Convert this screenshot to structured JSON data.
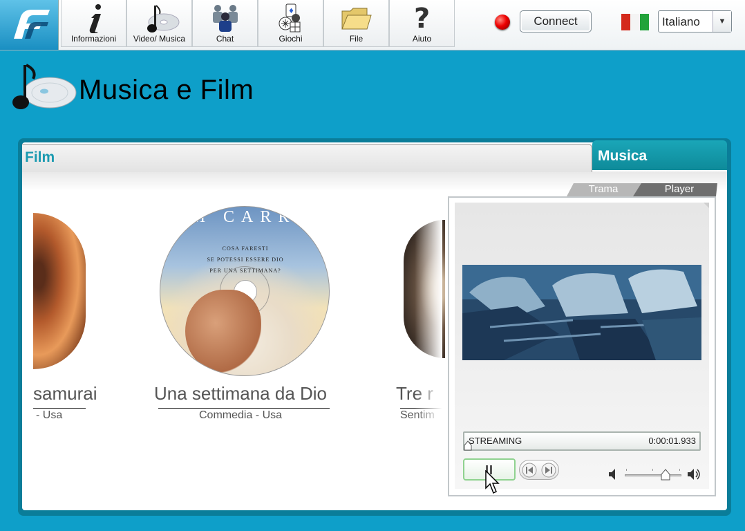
{
  "nav": {
    "items": [
      {
        "label": "Informazioni",
        "icon": "info-icon"
      },
      {
        "label": "Video/ Musica",
        "icon": "music-disc-icon"
      },
      {
        "label": "Chat",
        "icon": "chat-people-icon"
      },
      {
        "label": "Giochi",
        "icon": "games-icon"
      },
      {
        "label": "File",
        "icon": "folder-icon"
      },
      {
        "label": "Aiuto",
        "icon": "help-icon"
      }
    ]
  },
  "header": {
    "connect_label": "Connect",
    "status_color": "#e00000",
    "language": "Italiano",
    "flag_colors": [
      "#d42a1c",
      "#ffffff",
      "#22a33a"
    ]
  },
  "page": {
    "title": "Musica e Film"
  },
  "tabs": {
    "film": "Film",
    "musica": "Musica"
  },
  "carousel": {
    "items": [
      {
        "title": "samurai",
        "subtitle": "- Usa"
      },
      {
        "title": "Una settimana da Dio",
        "subtitle": "Commedia - Usa",
        "disc_text_top": "M CARR",
        "disc_text_lines": [
          "COSA FARESTI",
          "SE POTESSI ESSERE DIO",
          "PER UNA SETTIMANA?"
        ]
      },
      {
        "title": "Tre r",
        "subtitle": "Sentim"
      }
    ]
  },
  "player": {
    "subtabs": [
      "Trama",
      "Player"
    ],
    "status_text": "STREAMING",
    "time": "0:00:01.933",
    "progress": 0.02,
    "volume": 0.75
  },
  "colors": {
    "background": "#0e9fc9",
    "accent_teal": "#1a9ab0"
  }
}
